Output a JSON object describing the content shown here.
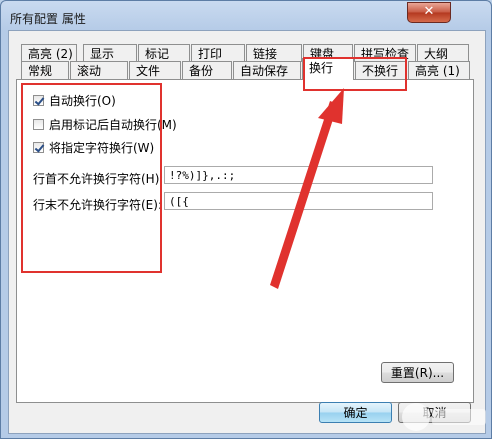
{
  "window": {
    "title": "所有配置 属性",
    "close_glyph": "✕"
  },
  "tabs_row1": [
    {
      "label": "高亮 (2)"
    },
    {
      "label": "显示"
    },
    {
      "label": "标记"
    },
    {
      "label": "打印"
    },
    {
      "label": "链接"
    },
    {
      "label": "键盘"
    },
    {
      "label": "拼写检查"
    },
    {
      "label": "大纲"
    }
  ],
  "tabs_row2": [
    {
      "label": "常规"
    },
    {
      "label": "滚动"
    },
    {
      "label": "文件"
    },
    {
      "label": "备份"
    },
    {
      "label": "自动保存"
    },
    {
      "label": "换行",
      "active": true
    },
    {
      "label": "不换行"
    },
    {
      "label": "高亮 (1)"
    }
  ],
  "options": {
    "auto_wrap": {
      "label": "自动换行(O)",
      "checked": true
    },
    "wrap_after_mark": {
      "label": "启用标记后自动换行(M)",
      "checked": false
    },
    "wrap_specified_chars": {
      "label": "将指定字符换行(W)",
      "checked": true
    }
  },
  "fields": {
    "line_start": {
      "label": "行首不允许换行字符(H):",
      "value": "!?%)]},.:;"
    },
    "line_end": {
      "label": "行末不允许换行字符(E):",
      "value": "([{"
    }
  },
  "buttons": {
    "reset": "重置(R)...",
    "ok": "确定",
    "cancel": "取消"
  },
  "annotations": {
    "highlight_color": "#e0322e"
  }
}
